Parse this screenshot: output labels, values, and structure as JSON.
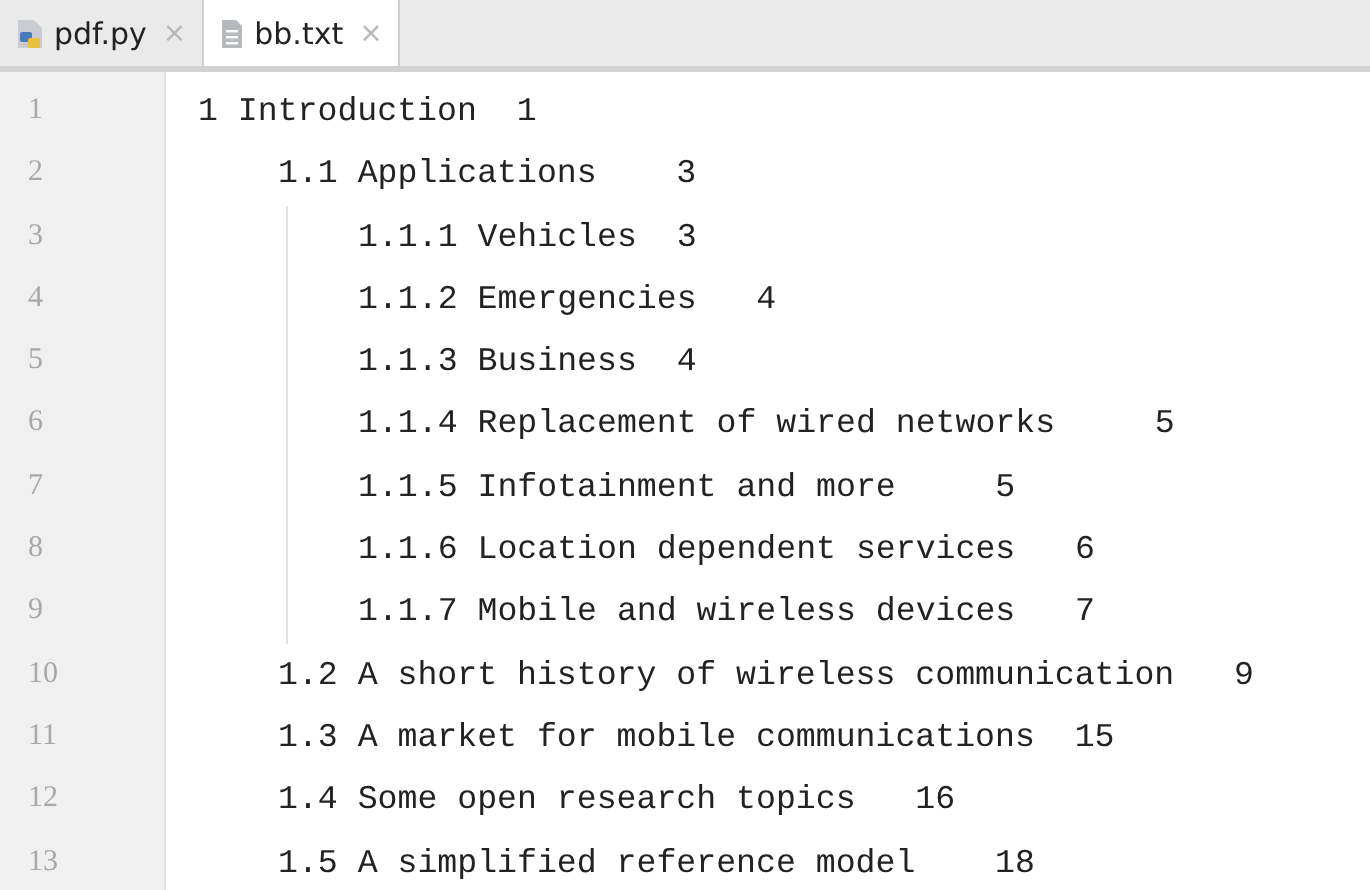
{
  "tabs": [
    {
      "label": "pdf.py",
      "kind": "python",
      "selected": false,
      "close": "×"
    },
    {
      "label": "bb.txt",
      "kind": "text",
      "selected": true,
      "close": "×"
    }
  ],
  "editor": {
    "lines": [
      {
        "number": "1",
        "text": "1 Introduction  1",
        "children": [
          {
            "number": "2",
            "text": "1.1 Applications    3",
            "children": [
              {
                "number": "3",
                "text": "1.1.1 Vehicles  3"
              },
              {
                "number": "4",
                "text": "1.1.2 Emergencies   4"
              },
              {
                "number": "5",
                "text": "1.1.3 Business  4"
              },
              {
                "number": "6",
                "text": "1.1.4 Replacement of wired networks     5"
              },
              {
                "number": "7",
                "text": "1.1.5 Infotainment and more     5"
              },
              {
                "number": "8",
                "text": "1.1.6 Location dependent services   6"
              },
              {
                "number": "9",
                "text": "1.1.7 Mobile and wireless devices   7"
              }
            ]
          },
          {
            "number": "10",
            "text": "1.2 A short history of wireless communication   9"
          },
          {
            "number": "11",
            "text": "1.3 A market for mobile communications  15"
          },
          {
            "number": "12",
            "text": "1.4 Some open research topics   16"
          },
          {
            "number": "13",
            "text": "1.5 A simplified reference model    18"
          }
        ]
      }
    ]
  }
}
